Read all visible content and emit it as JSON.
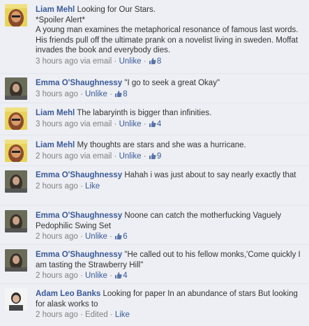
{
  "comments": [
    {
      "author": "Liam Mehl",
      "avatar": "liam-avatar",
      "text": "Looking for Our Stars.\n*Spoiler Alert*\nA young man examines the metaphorical resonance of famous last words. His friends pull off the ultimate prank on a novelist living in sweden. Moffat invades the book and everybody dies.",
      "time": "3 hours ago",
      "via": "via email",
      "action": "Unlike",
      "likes": "8"
    },
    {
      "author": "Emma O'Shaughnessy",
      "avatar": "emma-avatar",
      "text": "\"I go to seek a great Okay\"",
      "time": "3 hours ago",
      "via": "",
      "action": "Unlike",
      "likes": "8"
    },
    {
      "author": "Liam Mehl",
      "avatar": "liam-avatar",
      "text": "The labaryinth is bigger than infinities.",
      "time": "3 hours ago",
      "via": "via email",
      "action": "Unlike",
      "likes": "4"
    },
    {
      "author": "Liam Mehl",
      "avatar": "liam-avatar",
      "text": "My thoughts are stars and she was a hurricane.",
      "time": "2 hours ago",
      "via": "via email",
      "action": "Unlike",
      "likes": "9"
    },
    {
      "author": "Emma O'Shaughnessy",
      "avatar": "emma-avatar",
      "text": "Hahah i was just about to say nearly exactly that",
      "time": "2 hours ago",
      "via": "",
      "action": "Like",
      "likes": ""
    },
    {
      "author": "Emma O'Shaughnessy",
      "avatar": "emma-avatar",
      "text": "Noone can catch the motherfucking Vaguely Pedophilic Swing Set",
      "time": "2 hours ago",
      "via": "",
      "action": "Unlike",
      "likes": "6"
    },
    {
      "author": "Emma O'Shaughnessy",
      "avatar": "emma-avatar",
      "text": "\"He called out to his fellow monks,'Come quickly I am tasting the Strawberry Hill\"",
      "time": "2 hours ago",
      "via": "",
      "action": "Unlike",
      "likes": "4"
    },
    {
      "author": "Adam Leo Banks",
      "avatar": "adam-avatar",
      "text": "Looking for paper In an abundance of stars But looking for alask works to",
      "time": "2 hours ago",
      "via": "",
      "edited": "Edited",
      "action": "Like",
      "likes": ""
    }
  ],
  "colors": {
    "link": "#3b5998",
    "meta": "#808080",
    "background": "#edeff4"
  }
}
